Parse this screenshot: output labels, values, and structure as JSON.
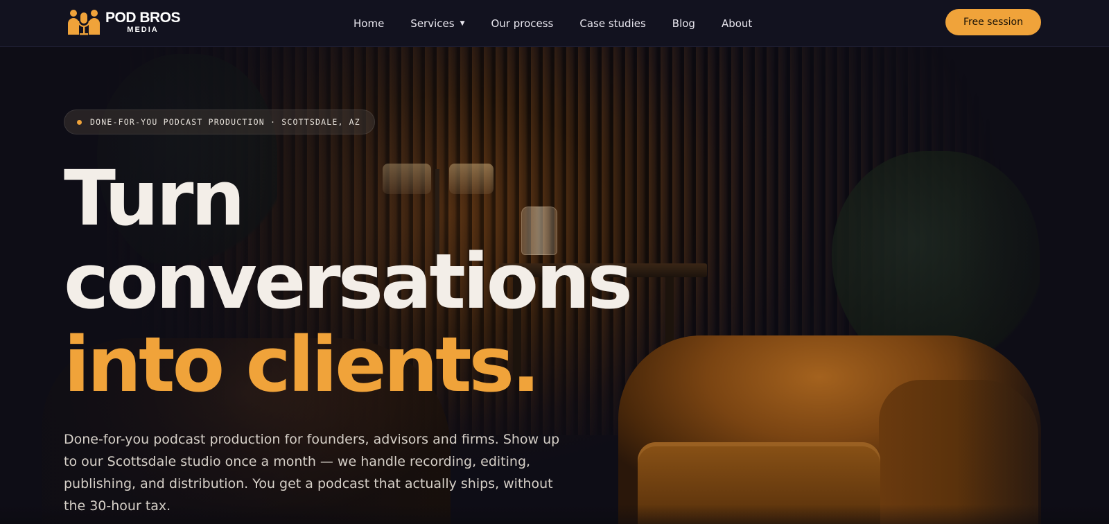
{
  "brand": {
    "name_line1": "POD BROS",
    "name_line2": "MEDIA",
    "logo_icon": "podcasters-microphone-logo",
    "accent_color": "#f0a33a"
  },
  "nav": {
    "items": [
      {
        "label": "Home"
      },
      {
        "label": "Services",
        "has_dropdown": true,
        "dropdown_icon": "caret-down"
      },
      {
        "label": "Our process"
      },
      {
        "label": "Case studies"
      },
      {
        "label": "Blog"
      },
      {
        "label": "About"
      }
    ],
    "cta_label": "Free session"
  },
  "hero": {
    "eyebrow": "DONE-FOR-YOU PODCAST PRODUCTION · SCOTTSDALE, AZ",
    "headline_line1": "Turn",
    "headline_line2": "conversations",
    "headline_line3": "into clients.",
    "description": "Done-for-you podcast production for founders, advisors and firms. Show up to our Scottsdale studio once a month — we handle recording, editing, publishing, and distribution. You get a podcast that actually ships, without the 30-hour tax."
  }
}
